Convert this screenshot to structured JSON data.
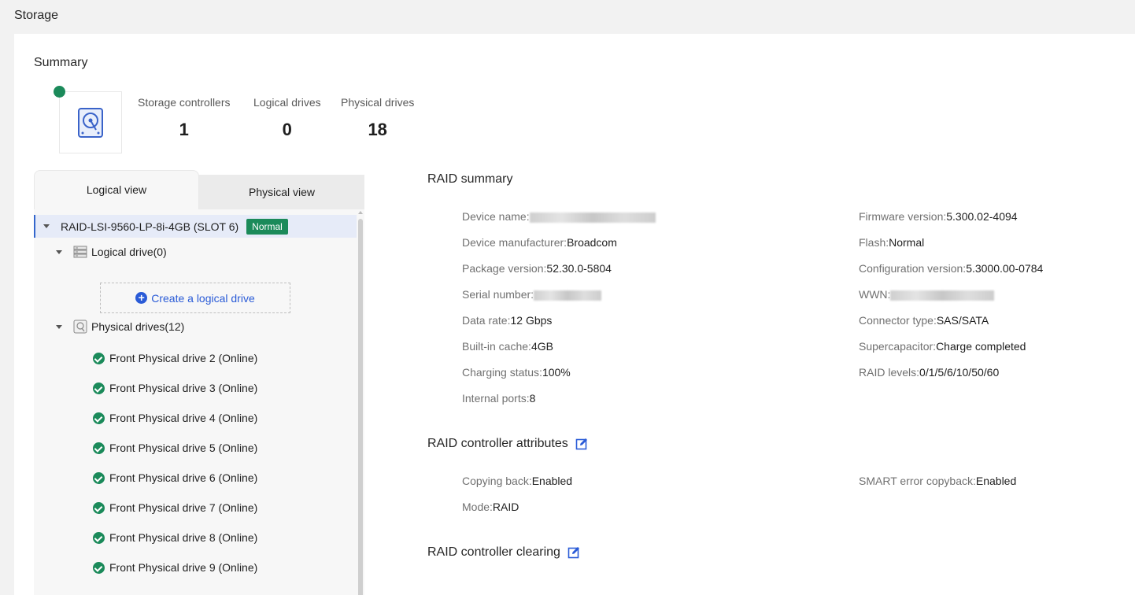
{
  "page_title": "Storage",
  "summary": {
    "title": "Summary",
    "stats": [
      {
        "label": "Storage controllers",
        "value": "1"
      },
      {
        "label": "Logical drives",
        "value": "0"
      },
      {
        "label": "Physical drives",
        "value": "18"
      }
    ]
  },
  "tabs": {
    "logical": "Logical view",
    "physical": "Physical view"
  },
  "tree": {
    "controller": "RAID-LSI-9560-LP-8i-4GB (SLOT 6)",
    "controller_status": "Normal",
    "logical_group": "Logical drive(0)",
    "create_label": "Create a logical drive",
    "physical_group": "Physical drives(12)",
    "drives": [
      "Front Physical drive 2 (Online)",
      "Front Physical drive 3 (Online)",
      "Front Physical drive 4 (Online)",
      "Front Physical drive 5 (Online)",
      "Front Physical drive 6 (Online)",
      "Front Physical drive 7 (Online)",
      "Front Physical drive 8 (Online)",
      "Front Physical drive 9 (Online)"
    ]
  },
  "raid_summary": {
    "title": "RAID summary",
    "left": [
      {
        "k": "Device name:",
        "v": ""
      },
      {
        "k": "Device manufacturer:",
        "v": "Broadcom"
      },
      {
        "k": "Package version:",
        "v": "52.30.0-5804"
      },
      {
        "k": "Serial number:",
        "v": ""
      },
      {
        "k": "Data rate:",
        "v": "12 Gbps"
      },
      {
        "k": "Built-in cache:",
        "v": "4GB"
      },
      {
        "k": "Charging status:",
        "v": "100%"
      },
      {
        "k": "Internal ports:",
        "v": "8"
      }
    ],
    "right": [
      {
        "k": "Firmware version:",
        "v": "5.300.02-4094"
      },
      {
        "k": "Flash:",
        "v": "Normal"
      },
      {
        "k": "Configuration version:",
        "v": "5.3000.00-0784"
      },
      {
        "k": "WWN:",
        "v": ""
      },
      {
        "k": "Connector type:",
        "v": "SAS/SATA"
      },
      {
        "k": "Supercapacitor:",
        "v": "Charge completed"
      },
      {
        "k": "RAID levels:",
        "v": "0/1/5/6/10/50/60"
      }
    ]
  },
  "attributes": {
    "title": "RAID controller attributes",
    "left": [
      {
        "k": "Copying back:",
        "v": "Enabled"
      },
      {
        "k": "Mode:",
        "v": "RAID"
      }
    ],
    "right": [
      {
        "k": "SMART error copyback:",
        "v": "Enabled"
      }
    ]
  },
  "clearing": {
    "title": "RAID controller clearing"
  },
  "colors": {
    "accent": "#2a5bd7",
    "ok": "#1b8a5a"
  }
}
